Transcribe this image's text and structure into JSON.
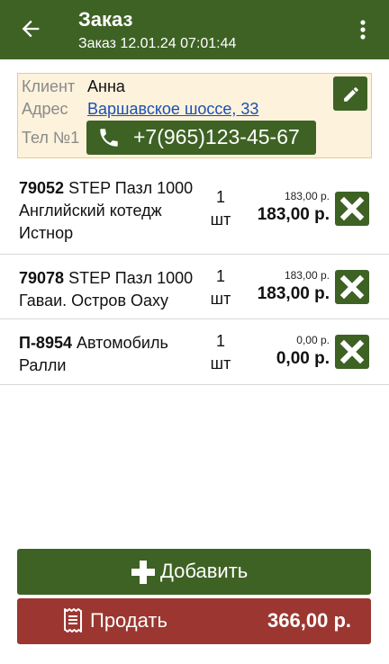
{
  "appbar": {
    "title": "Заказ",
    "subtitle": "Заказ 12.01.24 07:01:44"
  },
  "client": {
    "client_label": "Клиент",
    "client_value": "Анна",
    "address_label": "Адрес",
    "address_value": "Варшавское шоссе, 33",
    "phone_label": "Тел №1",
    "phone_value": "+7(965)123-45-67"
  },
  "items": [
    {
      "code": "79052",
      "name": "STEP Пазл 1000 Английский котедж Истнор",
      "qty": "1",
      "unit": "шт",
      "price": "183,00 р.",
      "sum": "183,00 р."
    },
    {
      "code": "79078",
      "name": "STEP Пазл 1000 Гаваи. Остров Оаху",
      "qty": "1",
      "unit": "шт",
      "price": "183,00 р.",
      "sum": "183,00 р."
    },
    {
      "code": "П-8954",
      "name": "Автомобиль Ралли",
      "qty": "1",
      "unit": "шт",
      "price": "0,00 р.",
      "sum": "0,00 р."
    }
  ],
  "actions": {
    "add_label": "Добавить",
    "sell_label": "Продать",
    "total": "366,00 р."
  },
  "colors": {
    "primary": "#3e6224",
    "danger": "#9b3730",
    "client_bg": "#fdf2dc",
    "client_border": "#f0c98a",
    "link": "#1a4fb5"
  },
  "icons": [
    "arrow-back-icon",
    "more-vert-icon",
    "pencil-icon",
    "phone-icon",
    "close-icon",
    "plus-icon",
    "receipt-icon"
  ]
}
